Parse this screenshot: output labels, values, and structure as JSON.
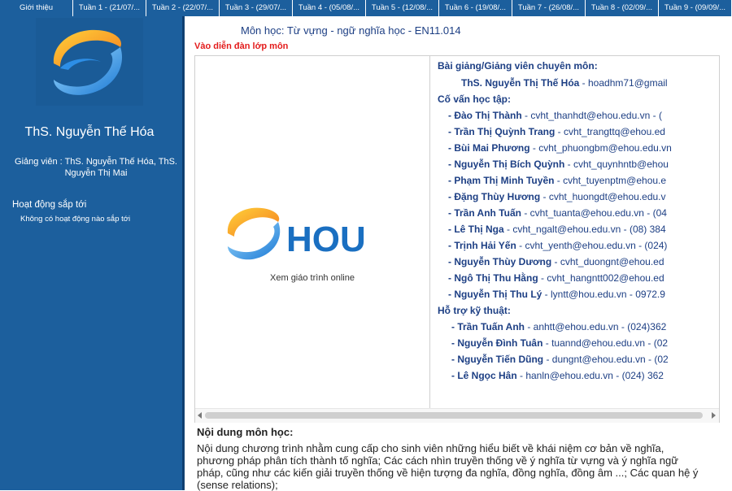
{
  "tabs": [
    "Giới thiệu",
    "Tuần 1 - (21/07/...",
    "Tuần 2 - (22/07/...",
    "Tuần 3 - (29/07/...",
    "Tuần 4 - (05/08/...",
    "Tuần 5 - (12/08/...",
    "Tuần 6 - (19/08/...",
    "Tuần 7 - (26/08/...",
    "Tuần 8 - (02/09/...",
    "Tuần 9 - (09/09/..."
  ],
  "sidebar": {
    "teacher_name": "ThS. Nguyễn Thế Hóa",
    "teacher_sub": "Giảng viên : ThS. Nguyễn Thế Hóa, ThS. Nguyễn Thị Mai",
    "upcoming_title": "Hoạt động sắp tới",
    "upcoming_empty": "Không có hoạt động nào sắp tới"
  },
  "course": {
    "title": "Môn học: Từ vựng - ngữ nghĩa học - EN11.014",
    "forum_link": "Vào diễn đàn lớp môn",
    "logo_text": "HOU",
    "online_link": "Xem giáo trình online"
  },
  "lecturers": {
    "heading": "Bài giảng/Giảng viên chuyên môn:",
    "items": [
      {
        "name": "ThS. Nguyễn Thị Thế Hóa",
        "detail": " - hoadhm71@gmail"
      }
    ]
  },
  "advisors": {
    "heading": "Cố vấn học tập:",
    "items": [
      {
        "name": "- Đào Thị Thành",
        "detail": " - cvht_thanhdt@ehou.edu.vn - ("
      },
      {
        "name": "- Trần Thị Quỳnh Trang",
        "detail": " - cvht_trangttq@ehou.ed"
      },
      {
        "name": "- Bùi Mai Phương",
        "detail": " - cvht_phuongbm@ehou.edu.vn"
      },
      {
        "name": "- Nguyễn Thị Bích Quỳnh",
        "detail": " - cvht_quynhntb@ehou"
      },
      {
        "name": "- Phạm Thị Minh Tuyền",
        "detail": " - cvht_tuyenptm@ehou.e"
      },
      {
        "name": "- Đặng Thùy Hương",
        "detail": " - cvht_huongdt@ehou.edu.v"
      },
      {
        "name": "- Trần Anh Tuấn",
        "detail": " - cvht_tuanta@ehou.edu.vn - (04"
      },
      {
        "name": "- Lê Thị Nga",
        "detail": " - cvht_ngalt@ehou.edu.vn - (08) 384"
      },
      {
        "name": "- Trịnh Hải Yến",
        "detail": " - cvht_yenth@ehou.edu.vn - (024)"
      },
      {
        "name": "- Nguyễn Thùy Dương",
        "detail": " - cvht_duongnt@ehou.ed"
      },
      {
        "name": "- Ngô Thị Thu Hằng",
        "detail": " - cvht_hangntt002@ehou.ed"
      },
      {
        "name": "- Nguyễn Thị Thu Lý",
        "detail": " - lyntt@hou.edu.vn - 0972.9"
      }
    ]
  },
  "support": {
    "heading": "Hỗ trợ kỹ thuật:",
    "items": [
      {
        "name": "- Trần Tuấn Anh",
        "detail": " - anhtt@ehou.edu.vn - (024)362"
      },
      {
        "name": "- Nguyễn Đình Tuân",
        "detail": " - tuannd@ehou.edu.vn - (02"
      },
      {
        "name": "- Nguyễn Tiến Dũng",
        "detail": " - dungnt@ehou.edu.vn - (02"
      },
      {
        "name": "- Lê Ngọc Hân",
        "detail": " - hanln@ehou.edu.vn - (024) 362"
      }
    ]
  },
  "content": {
    "heading": "Nội dung môn học:",
    "text": "Nội dung chương trình nhằm cung cấp cho sinh viên những hiểu biết về khái niệm cơ bản về nghĩa, phương pháp phân tích thành tố nghĩa; Các cách nhìn truyền thống về ý nghĩa từ vựng và ý nghĩa ngữ pháp, cũng như các kiến giải truyền thống về hiện tượng đa nghĩa, đồng nghĩa, đồng âm ...; Các quan hệ ý (sense relations);"
  },
  "colors": {
    "sidebar": "#1c5f9d",
    "title": "#1d3f84",
    "link_red": "#e31b1b"
  }
}
